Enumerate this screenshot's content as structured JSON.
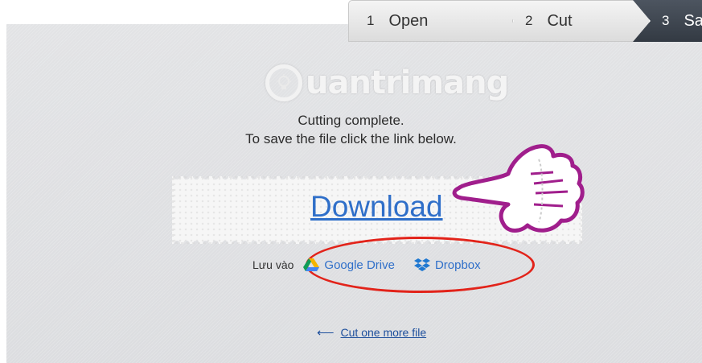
{
  "steps": [
    {
      "num": "1",
      "label": "Open"
    },
    {
      "num": "2",
      "label": "Cut"
    },
    {
      "num": "3",
      "label": "Sa"
    }
  ],
  "logo": {
    "text": "uantrimang",
    "icon": "lightbulb-icon"
  },
  "message": {
    "line1": "Cutting complete.",
    "line2": "To save the file click the link below."
  },
  "download": {
    "label": "Download"
  },
  "save_to": {
    "label": "Lưu vào",
    "options": [
      {
        "label": "Google Drive",
        "icon": "google-drive-icon"
      },
      {
        "label": "Dropbox",
        "icon": "dropbox-icon"
      }
    ]
  },
  "more": {
    "arrow": "⟵",
    "label": "Cut one more file"
  },
  "colors": {
    "link": "#2f6fc9",
    "highlight": "#e2231a",
    "hand": "#a01e8c",
    "active_step": "#3d444e"
  }
}
